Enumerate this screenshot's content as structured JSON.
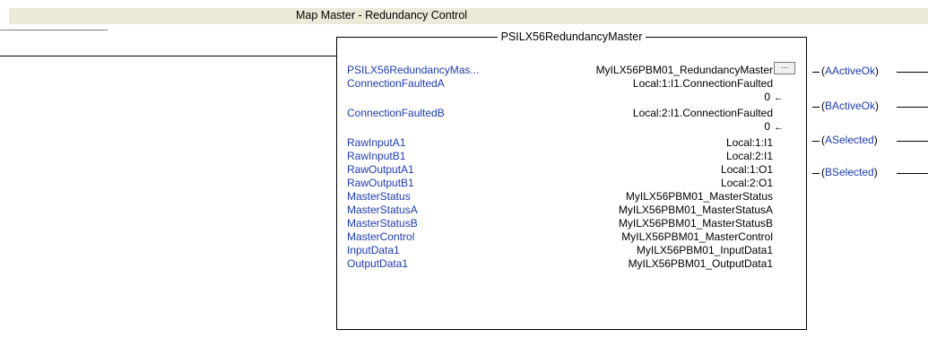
{
  "rung_comment": "Map Master - Redundancy Control",
  "aoi": {
    "title": "PSILX56RedundancyMaster",
    "ellipsis_label": "...",
    "params": [
      {
        "name": "PSILX56RedundancyMas...",
        "value": "MyILX56PBM01_RedundancyMaster"
      },
      {
        "name": "ConnectionFaultedA",
        "value": "Local:1:I1.ConnectionFaulted"
      },
      {
        "name": "",
        "value": "0"
      },
      {
        "name": "ConnectionFaultedB",
        "value": "Local:2:I1.ConnectionFaulted"
      },
      {
        "name": "",
        "value": "0"
      },
      {
        "name": "RawInputA1",
        "value": "Local:1:I1"
      },
      {
        "name": "RawInputB1",
        "value": "Local:2:I1"
      },
      {
        "name": "RawOutputA1",
        "value": "Local:1:O1"
      },
      {
        "name": "RawOutputB1",
        "value": "Local:2:O1"
      },
      {
        "name": "MasterStatus",
        "value": "MyILX56PBM01_MasterStatus"
      },
      {
        "name": "MasterStatusA",
        "value": "MyILX56PBM01_MasterStatusA"
      },
      {
        "name": "MasterStatusB",
        "value": "MyILX56PBM01_MasterStatusB"
      },
      {
        "name": "MasterControl",
        "value": "MyILX56PBM01_MasterControl"
      },
      {
        "name": "InputData1",
        "value": "MyILX56PBM01_InputData1"
      },
      {
        "name": "OutputData1",
        "value": "MyILX56PBM01_OutputData1"
      }
    ],
    "arrow": "←"
  },
  "coils": [
    {
      "label": "AActiveOk"
    },
    {
      "label": "BActiveOk"
    },
    {
      "label": "ASelected"
    },
    {
      "label": "BSelected"
    }
  ]
}
